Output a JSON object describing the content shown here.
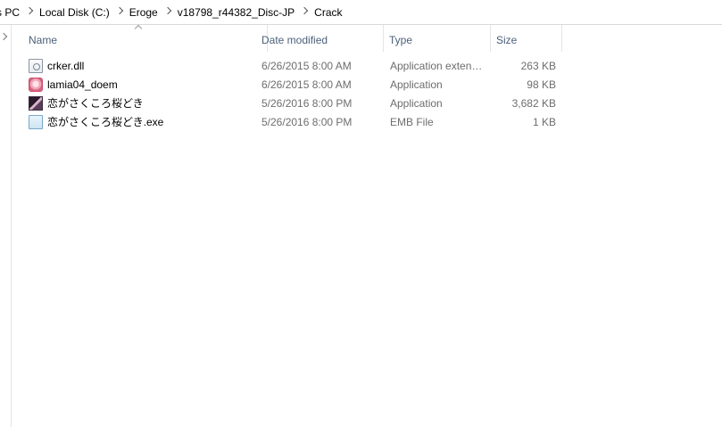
{
  "breadcrumb": {
    "items": [
      "s PC",
      "Local Disk (C:)",
      "Eroge",
      "v18798_r44382_Disc-JP",
      "Crack"
    ]
  },
  "columns": {
    "name": "Name",
    "date_modified": "Date modified",
    "type": "Type",
    "size": "Size"
  },
  "files": [
    {
      "name": "crker.dll",
      "date_modified": "6/26/2015 8:00 AM",
      "type": "Application exten…",
      "size": "263 KB",
      "icon": "dll-file-icon"
    },
    {
      "name": "lamia04_doem",
      "date_modified": "6/26/2015 8:00 AM",
      "type": "Application",
      "size": "98 KB",
      "icon": "application-icon"
    },
    {
      "name": "恋がさくころ桜どき",
      "date_modified": "5/26/2016 8:00 PM",
      "type": "Application",
      "size": "3,682 KB",
      "icon": "application-icon"
    },
    {
      "name": "恋がさくころ桜どき.exe",
      "date_modified": "5/26/2016 8:00 PM",
      "type": "EMB File",
      "size": "1 KB",
      "icon": "emb-file-icon"
    }
  ]
}
